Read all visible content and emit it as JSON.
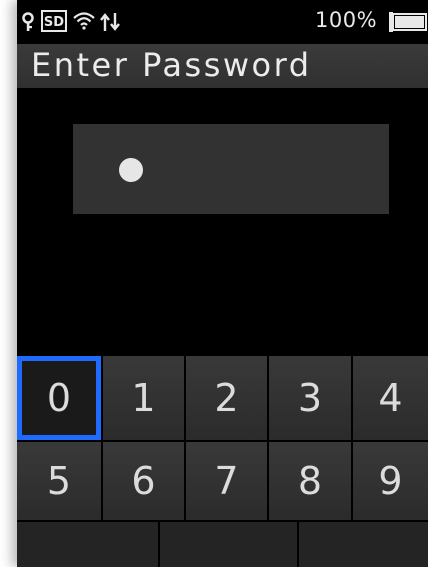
{
  "status": {
    "icons": [
      "key-icon",
      "sd-card-icon",
      "wifi-icon",
      "transfer-arrows-icon",
      "battery-icon"
    ],
    "sd_label": "SD",
    "battery_pct": "100%"
  },
  "title": "Enter Password",
  "password": {
    "dots": 1
  },
  "keypad": {
    "row1": [
      "0",
      "1",
      "2",
      "3",
      "4"
    ],
    "row2": [
      "5",
      "6",
      "7",
      "8",
      "9"
    ],
    "selected": "0"
  },
  "colors": {
    "selection": "#1f6bff",
    "background": "#000000"
  }
}
